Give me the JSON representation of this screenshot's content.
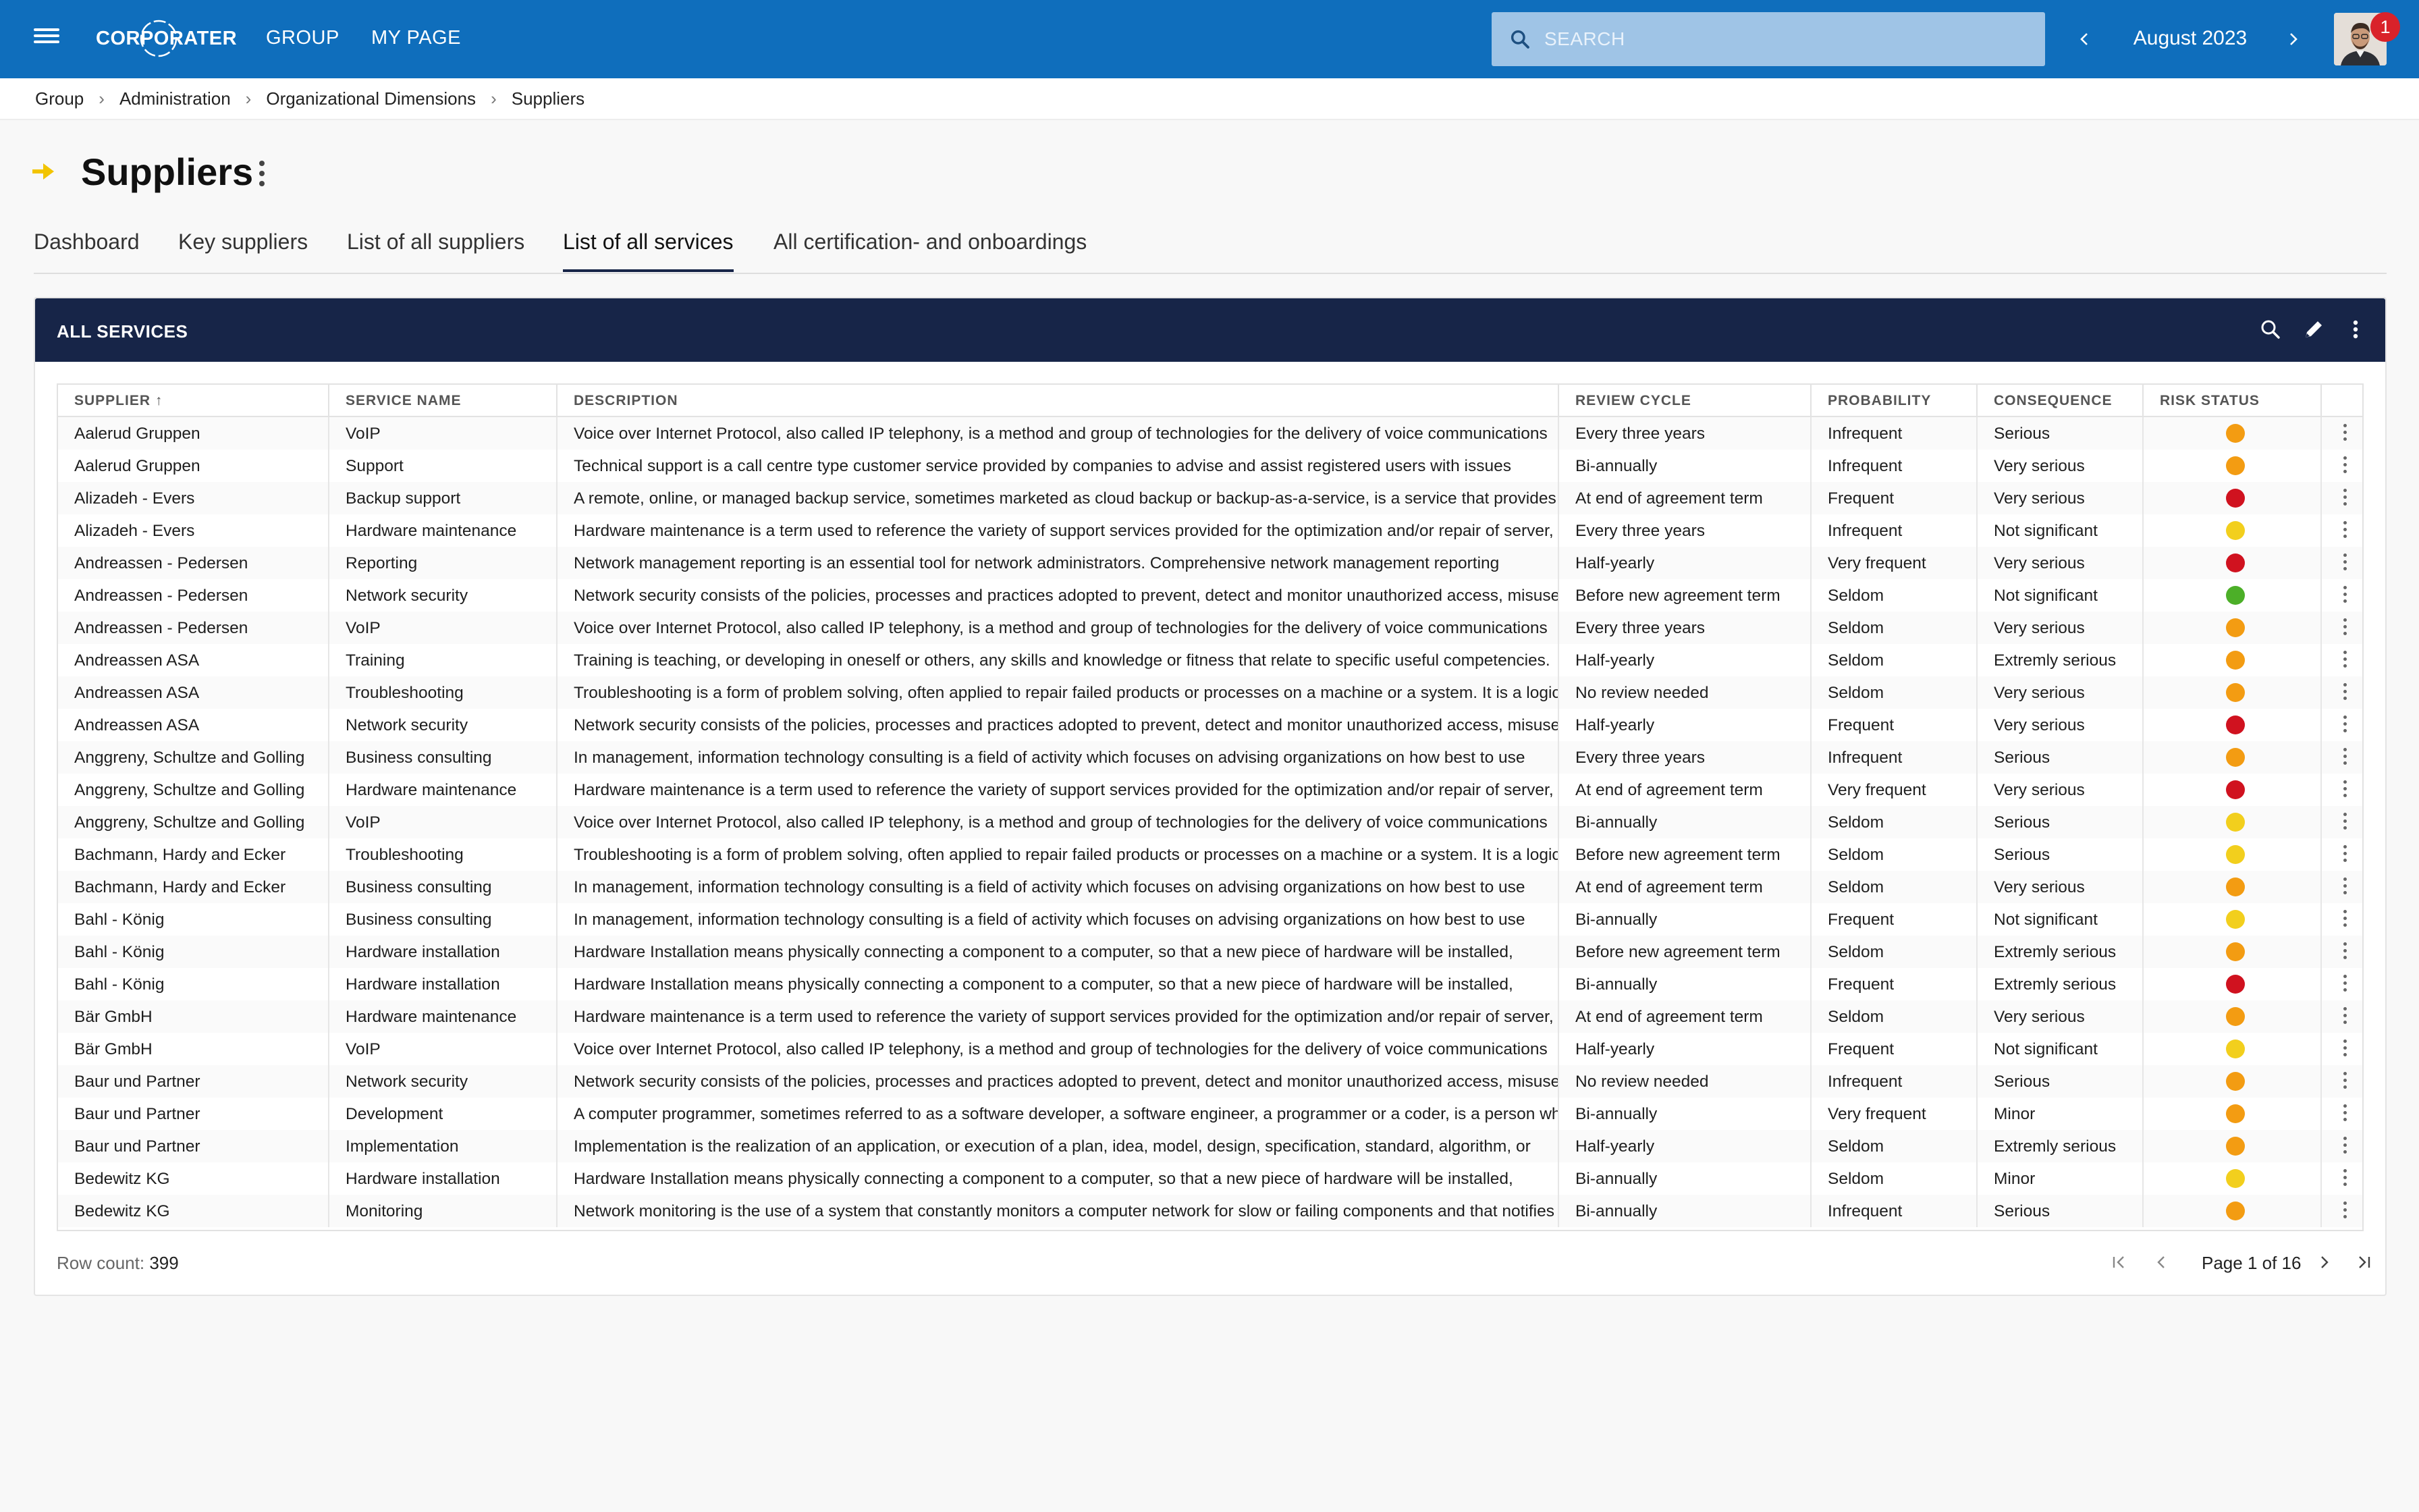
{
  "app": {
    "brand": "CORPORATER",
    "nav": [
      "GROUP",
      "MY PAGE"
    ],
    "search_placeholder": "SEARCH",
    "period": "August 2023",
    "notification_count": "1"
  },
  "breadcrumb": [
    "Group",
    "Administration",
    "Organizational Dimensions",
    "Suppliers"
  ],
  "page": {
    "title": "Suppliers",
    "tabs": [
      "Dashboard",
      "Key suppliers",
      "List of all suppliers",
      "List of all services",
      "All certification- and onboardings"
    ],
    "active_tab": "List of all services"
  },
  "card": {
    "title": "ALL SERVICES",
    "icons": [
      "search-icon",
      "edit-icon",
      "more-vertical-icon"
    ]
  },
  "table": {
    "columns": [
      "SUPPLIER ↑",
      "SERVICE NAME",
      "DESCRIPTION",
      "REVIEW CYCLE",
      "PROBABILITY",
      "CONSEQUENCE",
      "RISK STATUS"
    ],
    "status_colors": {
      "orange": "#f39c12",
      "red": "#d0121f",
      "yellow": "#f2cf1d",
      "green": "#4caf28"
    },
    "rows": [
      [
        "Aalerud Gruppen",
        "VoIP",
        "Voice over Internet Protocol, also called IP telephony, is a method and group of technologies for the delivery of voice communications",
        "Every three years",
        "Infrequent",
        "Serious",
        "orange"
      ],
      [
        "Aalerud Gruppen",
        "Support",
        "Technical support is a call centre type customer service provided by companies to advise and assist registered users with issues",
        "Bi-annually",
        "Infrequent",
        "Very serious",
        "orange"
      ],
      [
        "Alizadeh - Evers",
        "Backup support",
        "A remote, online, or managed backup service, sometimes marketed as cloud backup or backup-as-a-service, is a service that provides",
        "At end of agreement term",
        "Frequent",
        "Very serious",
        "red"
      ],
      [
        "Alizadeh - Evers",
        "Hardware maintenance",
        "Hardware maintenance is a term used to reference the variety of support services provided for the optimization and/or repair of server,",
        "Every three years",
        "Infrequent",
        "Not significant",
        "yellow"
      ],
      [
        "Andreassen - Pedersen",
        "Reporting",
        "Network management reporting is an essential tool for network administrators. Comprehensive network management reporting",
        "Half-yearly",
        "Very frequent",
        "Very serious",
        "red"
      ],
      [
        "Andreassen - Pedersen",
        "Network security",
        "Network security consists of the policies, processes and practices adopted to prevent, detect and monitor unauthorized access, misuse,",
        "Before new agreement term",
        "Seldom",
        "Not significant",
        "green"
      ],
      [
        "Andreassen - Pedersen",
        "VoIP",
        "Voice over Internet Protocol, also called IP telephony, is a method and group of technologies for the delivery of voice communications",
        "Every three years",
        "Seldom",
        "Very serious",
        "orange"
      ],
      [
        "Andreassen ASA",
        "Training",
        "Training is teaching, or developing in oneself or others, any skills and knowledge or fitness that relate to specific useful competencies.",
        "Half-yearly",
        "Seldom",
        "Extremly serious",
        "orange"
      ],
      [
        "Andreassen ASA",
        "Troubleshooting",
        "Troubleshooting is a form of problem solving, often applied to repair failed products or processes on a machine or a system. It is a logical,",
        "No review needed",
        "Seldom",
        "Very serious",
        "orange"
      ],
      [
        "Andreassen ASA",
        "Network security",
        "Network security consists of the policies, processes and practices adopted to prevent, detect and monitor unauthorized access, misuse,",
        "Half-yearly",
        "Frequent",
        "Very serious",
        "red"
      ],
      [
        "Anggreny, Schultze and Golling",
        "Business consulting",
        "In management, information technology consulting is a field of activity which focuses on advising organizations on how best to use",
        "Every three years",
        "Infrequent",
        "Serious",
        "orange"
      ],
      [
        "Anggreny, Schultze and Golling",
        "Hardware maintenance",
        "Hardware maintenance is a term used to reference the variety of support services provided for the optimization and/or repair of server,",
        "At end of agreement term",
        "Very frequent",
        "Very serious",
        "red"
      ],
      [
        "Anggreny, Schultze and Golling",
        "VoIP",
        "Voice over Internet Protocol, also called IP telephony, is a method and group of technologies for the delivery of voice communications",
        "Bi-annually",
        "Seldom",
        "Serious",
        "yellow"
      ],
      [
        "Bachmann, Hardy and Ecker",
        "Troubleshooting",
        "Troubleshooting is a form of problem solving, often applied to repair failed products or processes on a machine or a system. It is a logical,",
        "Before new agreement term",
        "Seldom",
        "Serious",
        "yellow"
      ],
      [
        "Bachmann, Hardy and Ecker",
        "Business consulting",
        "In management, information technology consulting is a field of activity which focuses on advising organizations on how best to use",
        "At end of agreement term",
        "Seldom",
        "Very serious",
        "orange"
      ],
      [
        "Bahl - König",
        "Business consulting",
        "In management, information technology consulting is a field of activity which focuses on advising organizations on how best to use",
        "Bi-annually",
        "Frequent",
        "Not significant",
        "yellow"
      ],
      [
        "Bahl - König",
        "Hardware installation",
        "Hardware Installation means physically connecting a component to a computer, so that a new piece of hardware will be installed,",
        "Before new agreement term",
        "Seldom",
        "Extremly serious",
        "orange"
      ],
      [
        "Bahl - König",
        "Hardware installation",
        "Hardware Installation means physically connecting a component to a computer, so that a new piece of hardware will be installed,",
        "Bi-annually",
        "Frequent",
        "Extremly serious",
        "red"
      ],
      [
        "Bär GmbH",
        "Hardware maintenance",
        "Hardware maintenance is a term used to reference the variety of support services provided for the optimization and/or repair of server,",
        "At end of agreement term",
        "Seldom",
        "Very serious",
        "orange"
      ],
      [
        "Bär GmbH",
        "VoIP",
        "Voice over Internet Protocol, also called IP telephony, is a method and group of technologies for the delivery of voice communications",
        "Half-yearly",
        "Frequent",
        "Not significant",
        "yellow"
      ],
      [
        "Baur und Partner",
        "Network security",
        "Network security consists of the policies, processes and practices adopted to prevent, detect and monitor unauthorized access, misuse,",
        "No review needed",
        "Infrequent",
        "Serious",
        "orange"
      ],
      [
        "Baur und Partner",
        "Development",
        "A computer programmer, sometimes referred to as a software developer, a software engineer, a programmer or a coder, is a person who",
        "Bi-annually",
        "Very frequent",
        "Minor",
        "orange"
      ],
      [
        "Baur und Partner",
        "Implementation",
        "Implementation is the realization of an application, or execution of a plan, idea, model, design, specification, standard, algorithm, or",
        "Half-yearly",
        "Seldom",
        "Extremly serious",
        "orange"
      ],
      [
        "Bedewitz KG",
        "Hardware installation",
        "Hardware Installation means physically connecting a component to a computer, so that a new piece of hardware will be installed,",
        "Bi-annually",
        "Seldom",
        "Minor",
        "yellow"
      ],
      [
        "Bedewitz KG",
        "Monitoring",
        "Network monitoring is the use of a system that constantly monitors a computer network for slow or failing components and that notifies",
        "Bi-annually",
        "Infrequent",
        "Serious",
        "orange"
      ]
    ]
  },
  "footer": {
    "row_count_label": "Row count:",
    "row_count": "399",
    "page_label": "Page 1 of 16"
  }
}
